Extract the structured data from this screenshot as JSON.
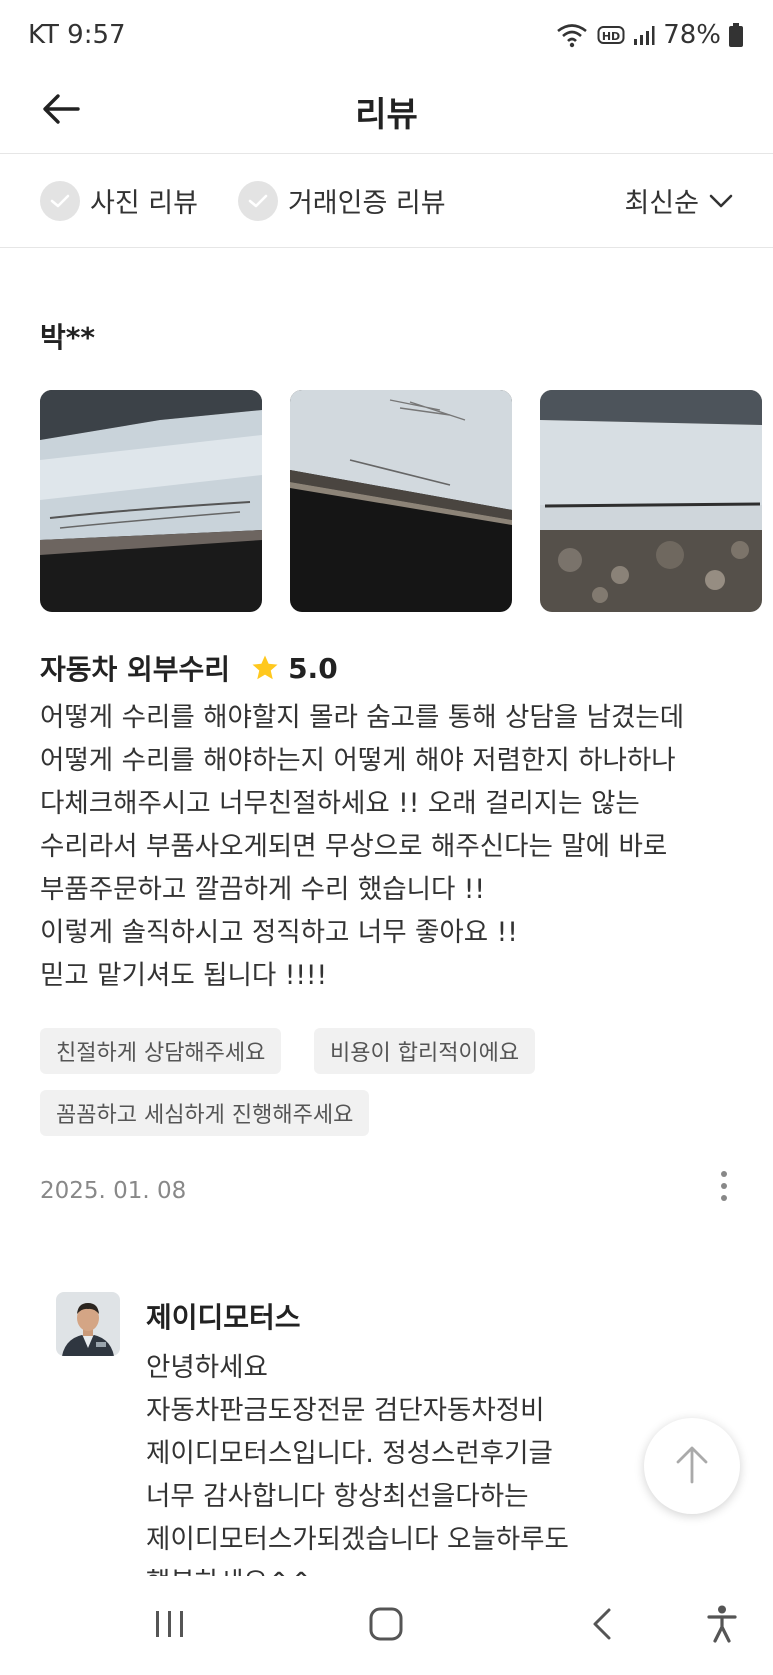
{
  "status_bar": {
    "carrier_time": "KT 9:57",
    "battery": "78%",
    "icons": [
      "wifi-icon",
      "hd-icon",
      "signal-icon",
      "battery-icon"
    ]
  },
  "header": {
    "title": "리뷰",
    "back_icon": "arrow-left-icon"
  },
  "filters": {
    "photo_review": "사진 리뷰",
    "verified_review": "거래인증 리뷰",
    "sort": "최신순"
  },
  "review": {
    "reviewer": "박**",
    "photo_count_visible": 3,
    "service": "자동차 외부수리",
    "rating": "5.0",
    "text_lines": [
      "어떻게 수리를 해야할지 몰라 숨고를 통해 상담을 남겼는데",
      "어떻게 수리를 해야하는지 어떻게 해야 저렴한지 하나하나",
      "다체크해주시고 너무친절하세요 !!  오래 걸리지는 않는",
      "수리라서 부품사오게되면 무상으로 해주신다는 말에 바로",
      "부품주문하고 깔끔하게 수리 했습니다 !!",
      "이렇게 솔직하시고 정직하고 너무 좋아요 !!",
      "믿고 맡기셔도 됩니다 !!!!"
    ],
    "tags": [
      "친절하게 상담해주세요",
      "비용이 합리적이에요",
      "꼼꼼하고 세심하게 진행해주세요"
    ],
    "date": "2025. 01. 08"
  },
  "reply": {
    "name": "제이디모터스",
    "text_lines": [
      "안녕하세요",
      "자동차판금도장전문 검단자동차정비",
      "제이디모터스입니다. 정성스런후기글",
      "너무 감사합니다 항상최선을다하는",
      "제이디모터스가되겠습니다 오늘하루도",
      "행복하세요^^"
    ]
  },
  "colors": {
    "star": "#FFC81E",
    "tag_bg": "#F1F1F1",
    "divider": "#E6E6E6"
  }
}
